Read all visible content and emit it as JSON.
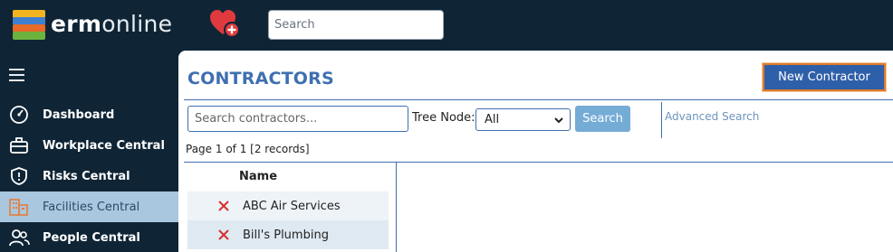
{
  "header": {
    "brand_bold": "erm",
    "brand_rest": "online",
    "search_placeholder": "Search"
  },
  "sidebar": {
    "items": [
      {
        "label": "Dashboard",
        "icon": "dashboard-gauge-icon"
      },
      {
        "label": "Workplace Central",
        "icon": "briefcase-icon"
      },
      {
        "label": "Risks Central",
        "icon": "shield-icon"
      },
      {
        "label": "Facilities Central",
        "icon": "buildings-icon",
        "active": true
      },
      {
        "label": "People Central",
        "icon": "people-icon"
      }
    ]
  },
  "main": {
    "title": "CONTRACTORS",
    "new_button": "New Contractor",
    "search_placeholder": "Search contractors...",
    "tree_node_label": "Tree Node:",
    "tree_node_value": "All",
    "search_button": "Search",
    "advanced_search": "Advanced Search",
    "paging": "Page 1 of 1 [2 records]",
    "column_name": "Name",
    "rows": [
      {
        "name": "ABC Air Services"
      },
      {
        "name": "Bill's Plumbing"
      }
    ]
  },
  "colors": {
    "background": "#0f2536",
    "accent": "#3f6fb1",
    "button": "#2e5fa9",
    "highlight_border": "#e07a2a",
    "delete": "#d62f2f"
  }
}
